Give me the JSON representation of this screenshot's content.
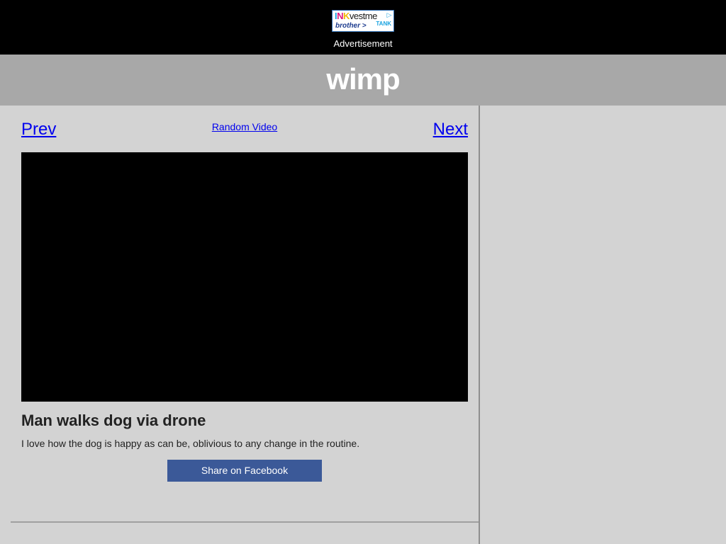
{
  "ad": {
    "banner_word_1": "I",
    "banner_word_2": "N",
    "banner_word_3": "K",
    "banner_word_rest": "vestme",
    "banner_sub": "brother >",
    "banner_tank": "TANK",
    "adchoice_icon": "triangle-icon",
    "label": "Advertisement"
  },
  "header": {
    "logo": "wimp"
  },
  "nav": {
    "prev": "Prev",
    "random": "Random Video",
    "next": "Next"
  },
  "video": {
    "title": "Man walks dog via drone",
    "description": "I love how the dog is happy as can be, oblivious to any change in the routine."
  },
  "share": {
    "facebook_label": "Share on Facebook",
    "facebook_color": "#3b5998"
  },
  "colors": {
    "ad_background": "#000000",
    "header_background": "#a8a8a8",
    "page_background": "#d3d3d3",
    "link": "#0000ee"
  }
}
